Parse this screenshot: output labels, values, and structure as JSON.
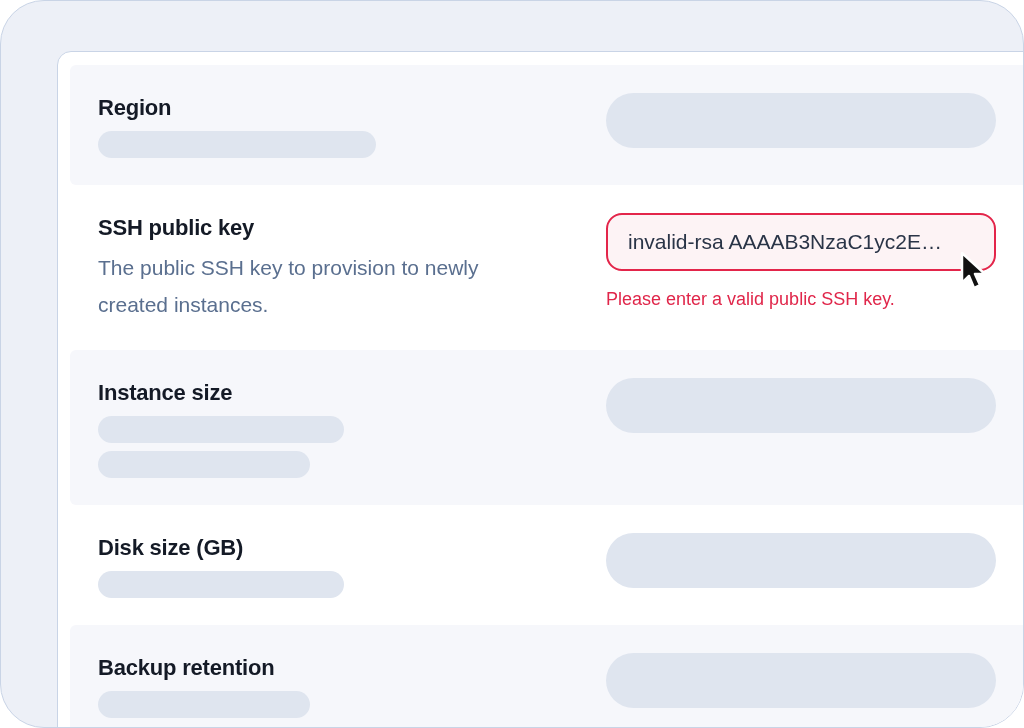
{
  "settings_rows": [
    {
      "label": "Region",
      "description_lines": [
        {
          "kind": "long"
        }
      ],
      "control": {
        "kind": "skeleton"
      }
    },
    {
      "label": "SSH public key",
      "description": "The public SSH key to provision to newly created instances.",
      "control": {
        "kind": "input",
        "value": "invalid-rsa AAAAB3NzaC1yc2E…",
        "invalid": true,
        "error": "Please enter a valid public SSH key."
      }
    },
    {
      "label": "Instance size",
      "description_lines": [
        {
          "kind": "medium"
        },
        {
          "kind": "short"
        }
      ],
      "control": {
        "kind": "skeleton"
      }
    },
    {
      "label": "Disk size (GB)",
      "description_lines": [
        {
          "kind": "medium"
        }
      ],
      "control": {
        "kind": "skeleton"
      }
    },
    {
      "label": "Backup retention",
      "description_lines": [
        {
          "kind": "short"
        }
      ],
      "control": {
        "kind": "skeleton"
      }
    }
  ]
}
